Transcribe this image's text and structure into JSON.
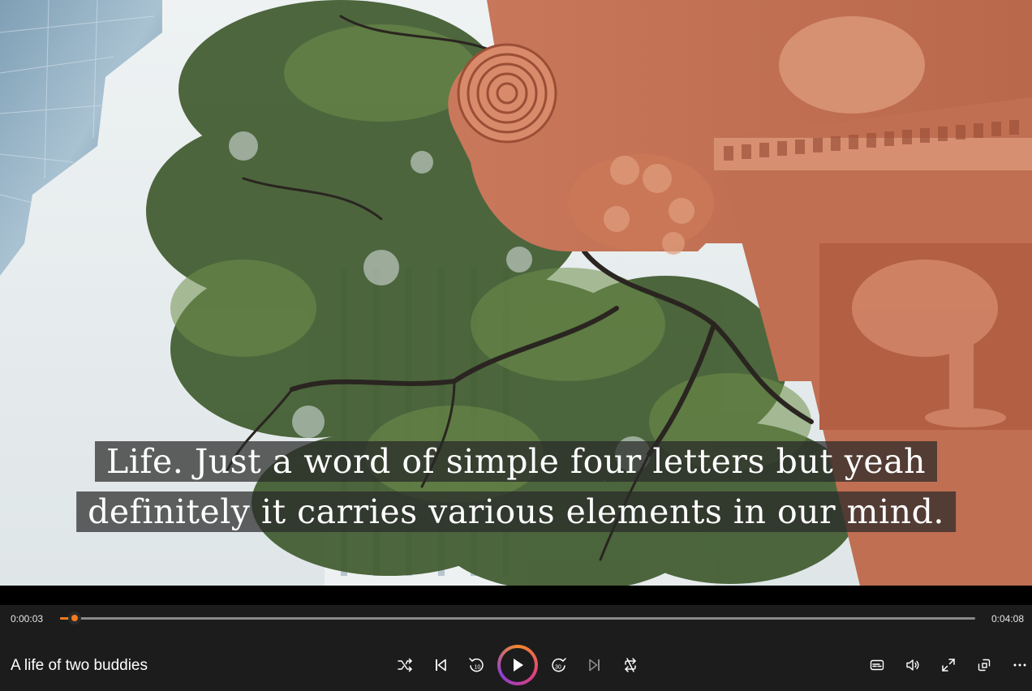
{
  "subtitle": {
    "line1": "Life. Just a word of simple four letters but yeah",
    "line2": "definitely it carries various elements in our mind."
  },
  "player": {
    "title": "A life of two buddies",
    "current_time": "0:00:03",
    "total_time": "0:04:08",
    "progress": 0.012,
    "accent_color": "#f47b20"
  },
  "controls": {
    "shuffle": "shuffle-icon",
    "previous": "previous-icon",
    "rewind": "rewind-10-icon",
    "rewind_label": "10",
    "play": "play-icon",
    "forward": "forward-30-icon",
    "forward_label": "30",
    "next": "next-icon",
    "repeat": "repeat-icon",
    "captions": "captions-icon",
    "volume": "volume-icon",
    "fullscreen": "fullscreen-icon",
    "miniplayer": "miniplayer-icon",
    "more": "more-icon"
  }
}
